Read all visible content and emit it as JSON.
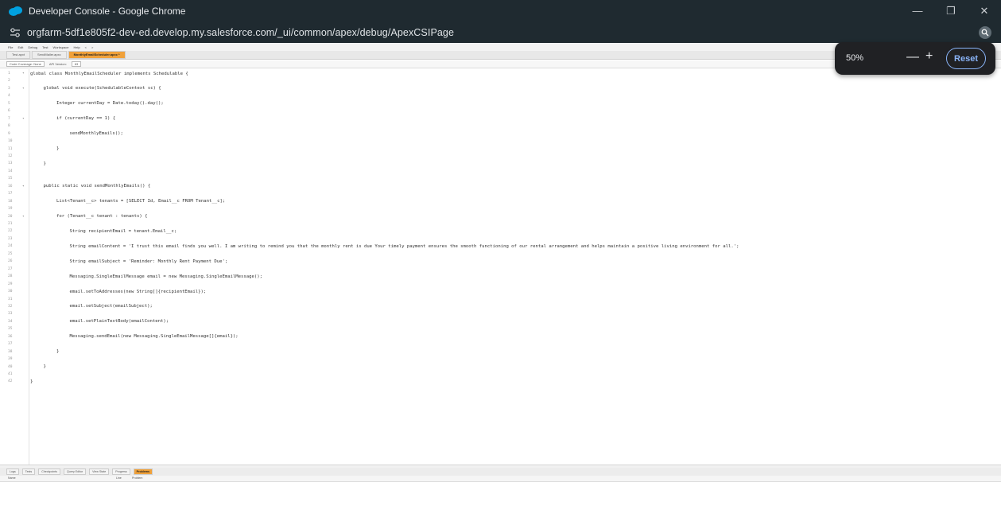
{
  "window": {
    "title": "Developer Console - Google Chrome",
    "controls": [
      "—",
      "❐",
      "✕"
    ]
  },
  "browser": {
    "url": "orgfarm-5df1e805f2-dev-ed.develop.my.salesforce.com/_ui/common/apex/debug/ApexCSIPage"
  },
  "zoom": {
    "level": "50%",
    "minus": "—",
    "plus": "+",
    "reset": "Reset"
  },
  "menu": [
    "File",
    "Edit",
    "Debug",
    "Test",
    "Workspace",
    "Help",
    "<",
    ">"
  ],
  "tabs": [
    {
      "label": "Test.apxt",
      "active": false
    },
    {
      "label": "SendMailer.apxc",
      "active": false
    },
    {
      "label": "MonthlyEmailScheduler.apxc *",
      "active": true
    }
  ],
  "toolbar": {
    "coverage": "Code Coverage: None",
    "api_label": "API Version:",
    "api_value": "63"
  },
  "code": {
    "lines": [
      {
        "n": "1",
        "fold": true,
        "text": "global class MonthlyEmailScheduler implements Schedulable {",
        "indent": 0,
        "color": "#333"
      },
      {
        "n": "2",
        "fold": false,
        "text": "",
        "indent": 0,
        "color": "#333"
      },
      {
        "n": "3",
        "fold": true,
        "text": "global void execute(SchedulableContext sc) {",
        "indent": 1,
        "color": "#333"
      },
      {
        "n": "4",
        "fold": false,
        "text": "",
        "indent": 0,
        "color": "#333"
      },
      {
        "n": "5",
        "fold": false,
        "text": "Integer currentDay = Date.today().day();",
        "indent": 2,
        "color": "#333"
      },
      {
        "n": "6",
        "fold": false,
        "text": "",
        "indent": 0,
        "color": "#333"
      },
      {
        "n": "7",
        "fold": true,
        "text": "if (currentDay == 1) {",
        "indent": 2,
        "color": "#333"
      },
      {
        "n": "8",
        "fold": false,
        "text": "",
        "indent": 0,
        "color": "#333"
      },
      {
        "n": "9",
        "fold": false,
        "text": "sendMonthlyEmails();",
        "indent": 3,
        "color": "#333"
      },
      {
        "n": "10",
        "fold": false,
        "text": "",
        "indent": 0,
        "color": "#333"
      },
      {
        "n": "11",
        "fold": false,
        "text": "}",
        "indent": 2,
        "color": "#333"
      },
      {
        "n": "12",
        "fold": false,
        "text": "",
        "indent": 0,
        "color": "#333"
      },
      {
        "n": "13",
        "fold": false,
        "text": "}",
        "indent": 1,
        "color": "#333"
      },
      {
        "n": "14",
        "fold": false,
        "text": "",
        "indent": 0,
        "color": "#333"
      },
      {
        "n": "15",
        "fold": false,
        "text": "",
        "indent": 0,
        "color": "#333"
      },
      {
        "n": "16",
        "fold": true,
        "text": "public static void sendMonthlyEmails() {",
        "indent": 1,
        "color": "#333"
      },
      {
        "n": "17",
        "fold": false,
        "text": "",
        "indent": 0,
        "color": "#333"
      },
      {
        "n": "18",
        "fold": false,
        "text": "List<Tenant__c> tenants = [SELECT Id, Email__c FROM Tenant__c];",
        "indent": 2,
        "color": "#333"
      },
      {
        "n": "19",
        "fold": false,
        "text": "",
        "indent": 0,
        "color": "#333"
      },
      {
        "n": "20",
        "fold": true,
        "text": "for (Tenant__c tenant : tenants) {",
        "indent": 2,
        "color": "#333"
      },
      {
        "n": "21",
        "fold": false,
        "text": "",
        "indent": 0,
        "color": "#333"
      },
      {
        "n": "22",
        "fold": false,
        "text": "String recipientEmail = tenant.Email__c;",
        "indent": 3,
        "color": "#333"
      },
      {
        "n": "23",
        "fold": false,
        "text": "",
        "indent": 0,
        "color": "#333"
      },
      {
        "n": "24",
        "fold": false,
        "text": "String emailContent = 'I trust this email finds you well. I am writing to remind you that the monthly rent  is due Your timely payment ensures the smooth functioning of our rental arrangement and helps maintain a positive living environment for all.';",
        "indent": 3,
        "color": "#333"
      },
      {
        "n": "25",
        "fold": false,
        "text": "",
        "indent": 0,
        "color": "#333"
      },
      {
        "n": "26",
        "fold": false,
        "text": "String emailSubject = 'Reminder: Monthly Rent Payment Due';",
        "indent": 3,
        "color": "#333"
      },
      {
        "n": "27",
        "fold": false,
        "text": "",
        "indent": 0,
        "color": "#333"
      },
      {
        "n": "28",
        "fold": false,
        "text": "Messaging.SingleEmailMessage email = new Messaging.SingleEmailMessage();",
        "indent": 3,
        "color": "#333"
      },
      {
        "n": "29",
        "fold": false,
        "text": "",
        "indent": 0,
        "color": "#333"
      },
      {
        "n": "30",
        "fold": false,
        "text": "email.setToAddresses(new String[]{recipientEmail});",
        "indent": 3,
        "color": "#333"
      },
      {
        "n": "31",
        "fold": false,
        "text": "",
        "indent": 0,
        "color": "#333"
      },
      {
        "n": "32",
        "fold": false,
        "text": "email.setSubject(emailSubject);",
        "indent": 3,
        "color": "#333"
      },
      {
        "n": "33",
        "fold": false,
        "text": "",
        "indent": 0,
        "color": "#333"
      },
      {
        "n": "34",
        "fold": false,
        "text": "email.setPlainTextBody(emailContent);",
        "indent": 3,
        "color": "#333"
      },
      {
        "n": "35",
        "fold": false,
        "text": "",
        "indent": 0,
        "color": "#333"
      },
      {
        "n": "36",
        "fold": false,
        "text": " Messaging.sendEmail(new Messaging.SingleEmailMessage[]{email});",
        "indent": 3,
        "color": "#333"
      },
      {
        "n": "37",
        "fold": false,
        "text": "",
        "indent": 0,
        "color": "#333"
      },
      {
        "n": "38",
        "fold": false,
        "text": "}",
        "indent": 2,
        "color": "#333"
      },
      {
        "n": "39",
        "fold": false,
        "text": "",
        "indent": 0,
        "color": "#333"
      },
      {
        "n": "40",
        "fold": false,
        "text": "}",
        "indent": 1,
        "color": "#333"
      },
      {
        "n": "41",
        "fold": false,
        "text": "",
        "indent": 0,
        "color": "#333"
      },
      {
        "n": "42",
        "fold": false,
        "text": "}",
        "indent": 0,
        "color": "#333"
      }
    ]
  },
  "bottom_tabs": [
    {
      "label": "Logs",
      "active": false
    },
    {
      "label": "Tests",
      "active": false
    },
    {
      "label": "Checkpoints",
      "active": false
    },
    {
      "label": "Query Editor",
      "active": false
    },
    {
      "label": "View State",
      "active": false
    },
    {
      "label": "Progress",
      "active": false
    },
    {
      "label": "Problems",
      "active": true
    }
  ],
  "problems_columns": [
    "Name",
    "Line",
    "Problem"
  ],
  "colors": {
    "titlebar": "#1f2a30",
    "active_tab": "#f0a13a",
    "zoom_accent": "#8ab4f8"
  }
}
